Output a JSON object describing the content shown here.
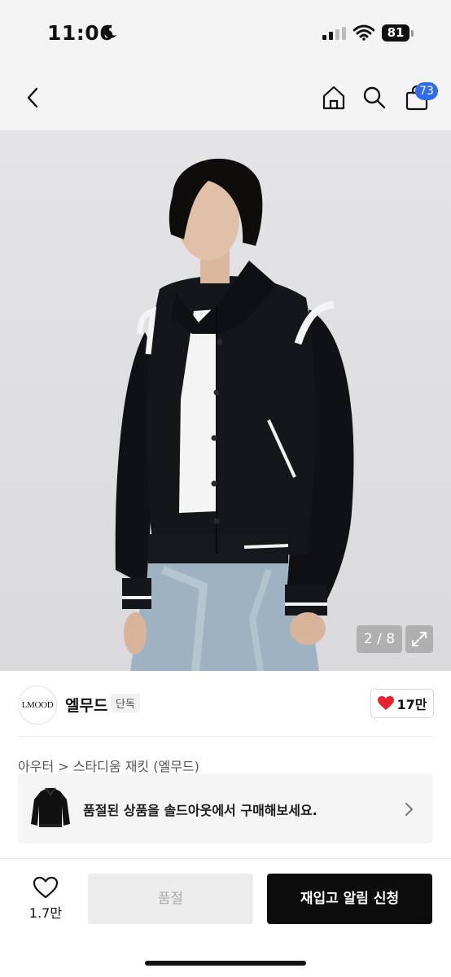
{
  "status_bar": {
    "time": "11:06",
    "battery": "81"
  },
  "nav": {
    "cart_count": "73"
  },
  "gallery": {
    "page_indicator": "2 / 8"
  },
  "brand": {
    "logo_text": "LMOOD",
    "name": "엘무드",
    "tag": "단독",
    "like_count": "17만"
  },
  "category": {
    "breadcrumb": "아우터 > 스타디움 재킷 (엘무드)"
  },
  "soldout_banner": {
    "text": "품절된 상품을 솔드아웃에서 구매해보세요."
  },
  "bottom_bar": {
    "wish_count": "1.7만",
    "soldout_label": "품절",
    "restock_label": "재입고 알림 신청"
  },
  "colors": {
    "accent_blue": "#2f6bf0",
    "like_red": "#e8202f",
    "primary_black": "#0c0c0c"
  }
}
